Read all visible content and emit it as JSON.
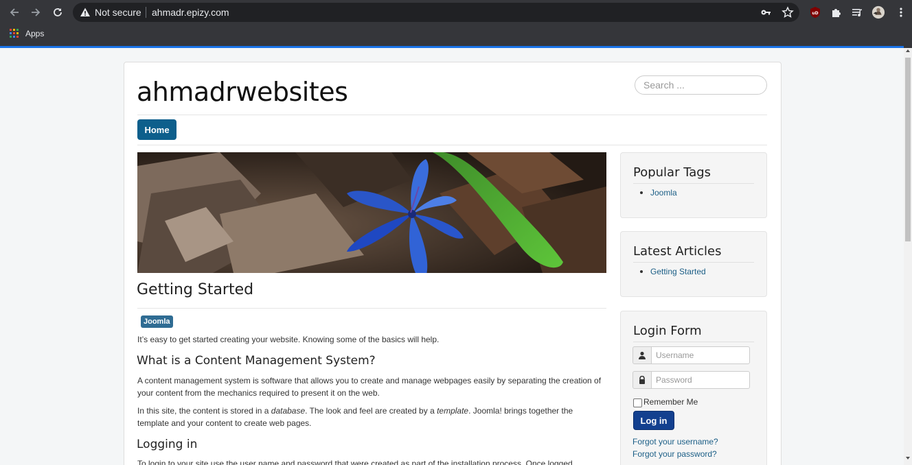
{
  "browser": {
    "security_label": "Not secure",
    "url": "ahmadr.epizy.com",
    "bookmarks_apps_label": "Apps",
    "icons": [
      "back-arrow-icon",
      "forward-arrow-icon",
      "reload-icon",
      "warning-icon",
      "key-icon",
      "star-icon",
      "ublock-icon",
      "puzzle-icon",
      "media-queue-icon",
      "profile-avatar-icon",
      "kebab-menu-icon"
    ]
  },
  "site": {
    "title": "ahmadrwebsites",
    "search_placeholder": "Search ...",
    "nav_home": "Home"
  },
  "article": {
    "title": "Getting Started",
    "tag": "Joomla",
    "intro": "It’s easy to get started creating your website. Knowing some of the basics will help.",
    "h_cms": "What is a Content Management System?",
    "p_cms": "A content management system is software that allows you to create and manage webpages easily by separating the creation of your content from the mechanics required to present it on the web.",
    "p_site_1": "In this site, the content is stored in a ",
    "p_site_db": "database",
    "p_site_2": ". The look and feel are created by a ",
    "p_site_tpl": "template",
    "p_site_3": ". Joomla! brings together the template and your content to create web pages.",
    "h_login": "Logging in",
    "p_login": "To login to your site use the user name and password that were created as part of the installation process. Once logged"
  },
  "sidebar": {
    "popular_tags_title": "Popular Tags",
    "popular_tags": [
      "Joomla"
    ],
    "latest_articles_title": "Latest Articles",
    "latest_articles": [
      "Getting Started"
    ],
    "login_title": "Login Form",
    "username_placeholder": "Username",
    "password_placeholder": "Password",
    "remember_me": "Remember Me",
    "login_button": "Log in",
    "forgot_username": "Forgot your username?",
    "forgot_password": "Forgot your password?"
  },
  "colors": {
    "chrome_bg": "#35363a",
    "omnibox_bg": "#202124",
    "accent_blue": "#0d5f8c",
    "link": "#1b5e86",
    "login_button": "#13408f"
  }
}
